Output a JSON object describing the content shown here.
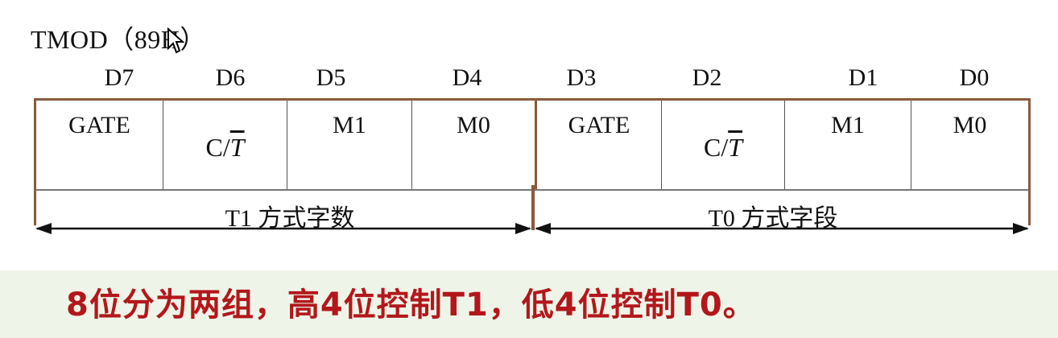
{
  "title": "TMOD（89H）",
  "bits": [
    "D7",
    "D6",
    "D5",
    "D4",
    "D3",
    "D2",
    "D1",
    "D0"
  ],
  "cells": [
    {
      "text": "GATE",
      "position": "high"
    },
    {
      "prefix": "C/",
      "over": "T",
      "position": "low"
    },
    {
      "text": "M1",
      "position": "high"
    },
    {
      "text": "M0",
      "position": "high"
    },
    {
      "text": "GATE",
      "position": "high"
    },
    {
      "prefix": "C/",
      "over": "T",
      "position": "low"
    },
    {
      "text": "M1",
      "position": "high"
    },
    {
      "text": "M0",
      "position": "high"
    }
  ],
  "groups": {
    "high": "T1 方式字数",
    "low": "T0 方式字段"
  },
  "banner": "8位分为两组，高4位控制T1，低4位控制T0。",
  "colors": {
    "frame": "#8a5a3a",
    "banner_bg": "#eef5e8",
    "banner_text": "#b3171b"
  },
  "icons": {
    "cursor": "arrow-pointer-icon"
  }
}
